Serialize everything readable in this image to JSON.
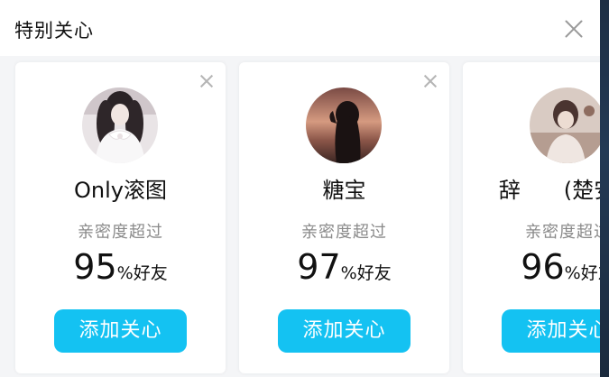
{
  "header": {
    "title": "特别关心"
  },
  "cards": [
    {
      "name": "Only滚图",
      "affinity_label": "亲密度超过",
      "percent": "95",
      "percent_suffix": "%好友",
      "button_label": "添加关心"
    },
    {
      "name": "糖宝",
      "affinity_label": "亲密度超过",
      "percent": "97",
      "percent_suffix": "%好友",
      "button_label": "添加关心"
    },
    {
      "name": "辞　　(楚安年",
      "affinity_label": "亲密度超过",
      "percent": "96",
      "percent_suffix": "%好友",
      "button_label": "添加关心"
    }
  ],
  "colors": {
    "accent": "#14c2f2",
    "card_bg": "#ffffff",
    "panel_bg": "#f4f5f7",
    "muted_text": "#8a8a8a"
  },
  "icons": {
    "dialog_close": "close-icon",
    "card_dismiss": "close-icon"
  }
}
